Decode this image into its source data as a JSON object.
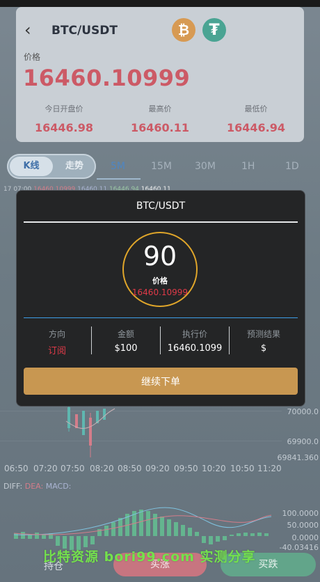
{
  "header": {
    "pair": "BTC/USDT",
    "price_label": "价格",
    "price": "16460.10999",
    "stats": [
      {
        "label": "今日开盘价",
        "value": "16446.98"
      },
      {
        "label": "最高价",
        "value": "16460.11"
      },
      {
        "label": "最低价",
        "value": "16446.94"
      }
    ]
  },
  "chart_toggle": {
    "kline": "K线",
    "trend": "走势"
  },
  "intervals": [
    "5M",
    "15M",
    "30M",
    "1H",
    "1D"
  ],
  "active_interval": "5M",
  "ma_line": {
    "time": "17 07:00",
    "v1": "16460.10999",
    "v2": "16460.11",
    "v3": "16446.94",
    "v4": "16460.11"
  },
  "chart_axis": {
    "y": [
      "70000.0",
      "69900.0",
      "69841.360"
    ],
    "x": [
      "06:50",
      "07:20",
      "07:50",
      "08:20",
      "08:50",
      "09:20",
      "09:50",
      "10:20",
      "10:50",
      "11:20"
    ],
    "macd_y": [
      "100.0000",
      "50.0000",
      "0.0000",
      "-40.03416"
    ]
  },
  "indicator": {
    "diff": "DIFF:",
    "dea": "DEA:",
    "macd": "MACD:"
  },
  "dialog": {
    "title": "BTC/USDT",
    "countdown": "90",
    "countdown_label": "价格",
    "countdown_price": "16460.10999",
    "columns": [
      {
        "head": "方向",
        "value": "订阅"
      },
      {
        "head": "金额",
        "value": "$100"
      },
      {
        "head": "执行价",
        "value": "16460.1099"
      },
      {
        "head": "预测结果",
        "value": "$"
      }
    ],
    "continue_button": "继续下单"
  },
  "bottom": {
    "position": "持仓",
    "up": "买涨",
    "down": "买跌"
  },
  "watermark": "比特资源 bori99.com 实测分享",
  "colors": {
    "accent_gold": "#c89751",
    "price_red": "#cc5a66",
    "up_green": "#62a58a"
  }
}
